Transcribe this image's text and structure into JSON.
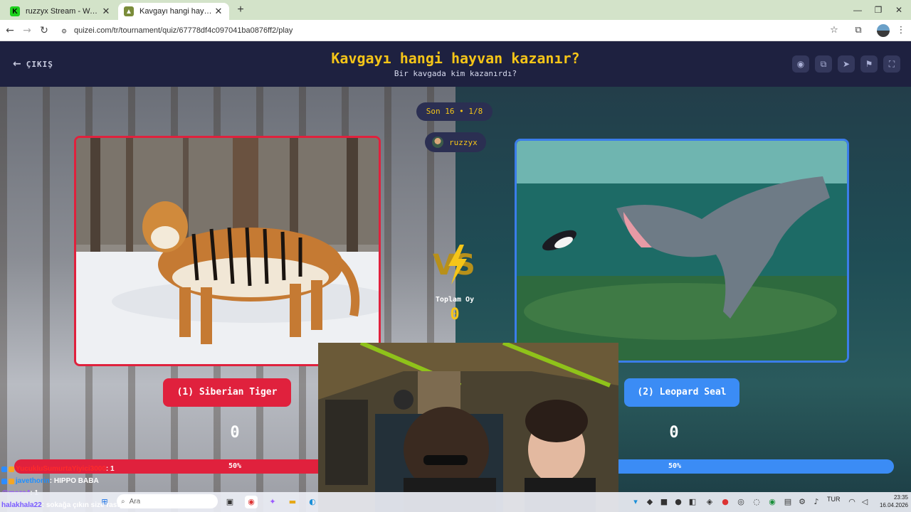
{
  "browser": {
    "tabs": [
      {
        "title": "ruzzyx Stream - Watch Live on",
        "icon": "kick-icon",
        "favicon_text": "K"
      },
      {
        "title": "Kavgayı hangi hayvan kazanır?",
        "icon": "quizei-icon",
        "favicon_text": ""
      }
    ],
    "url": "quizei.com/tr/tournament/quiz/67778df4c097041ba0876ff2/play"
  },
  "header": {
    "back_label": "ÇIKIŞ",
    "title": "Kavgayı hangi hayvan kazanır?",
    "subtitle": "Bir kavgada kim kazanırdı?",
    "actions": [
      "eye-icon",
      "copy-icon",
      "send-icon",
      "flag-icon",
      "fullscreen-icon"
    ]
  },
  "round": {
    "label": "Son 16 • 1/8",
    "user": "ruzzyx",
    "total_label": "Toplam Oy",
    "total_value": "0"
  },
  "options": [
    {
      "label": "(1) Siberian Tiger",
      "score": "0",
      "percent_text": "50%",
      "percent": 50,
      "color": "#e0213d"
    },
    {
      "label": "(2) Leopard Seal",
      "score": "0",
      "percent_text": "50%",
      "percent": 50,
      "color": "#3b8cf5"
    }
  ],
  "chat": [
    {
      "user": "YucukluSumurtaYiyici3000",
      "message": " : 1",
      "color": "#ff2a2a"
    },
    {
      "user": "javethorin",
      "message": " : HIPPO BABA",
      "color": "#1f8fff"
    },
    {
      "user": "@meza4",
      "message": " : 1",
      "color": "#9b59ff"
    },
    {
      "user": "halakhala22",
      "message": " : sokağa çıkın size rastgele challengelar verelim",
      "color": "#7a5cff"
    }
  ],
  "taskbar": {
    "search_placeholder": "Ara",
    "lang": "TUR",
    "time": "23:35",
    "date": "16.04.2026"
  }
}
